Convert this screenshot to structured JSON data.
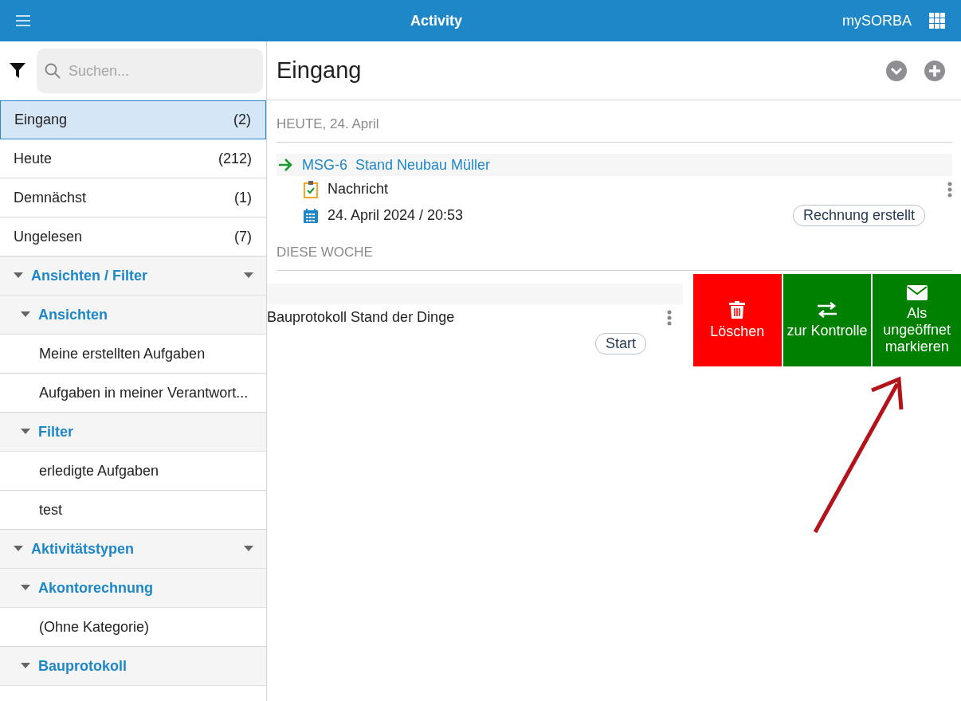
{
  "topbar": {
    "title": "Activity",
    "brand": "mySORBA"
  },
  "sidebar": {
    "search": {
      "placeholder": "Suchen..."
    },
    "nav": [
      {
        "label": "Eingang",
        "count": "(2)",
        "selected": true
      },
      {
        "label": "Heute",
        "count": "(212)",
        "selected": false
      },
      {
        "label": "Demnächst",
        "count": "(1)",
        "selected": false
      },
      {
        "label": "Ungelesen",
        "count": "(7)",
        "selected": false
      }
    ],
    "sections": [
      {
        "label": "Ansichten / Filter",
        "expanded": true,
        "children": [
          {
            "label": "Ansichten",
            "expanded": true,
            "children": [
              {
                "label": "Meine erstellten Aufgaben"
              },
              {
                "label": "Aufgaben in meiner Verantwort..."
              }
            ]
          },
          {
            "label": "Filter",
            "expanded": true,
            "children": [
              {
                "label": "erledigte Aufgaben"
              },
              {
                "label": "test"
              }
            ]
          }
        ]
      },
      {
        "label": "Aktivitätstypen",
        "expanded": true,
        "children": [
          {
            "label": "Akontorechnung",
            "expanded": true,
            "children": [
              {
                "label": "(Ohne Kategorie)"
              }
            ]
          },
          {
            "label": "Bauprotokoll",
            "expanded": true
          }
        ]
      }
    ]
  },
  "main": {
    "title": "Eingang",
    "groups": [
      {
        "heading": "HEUTE, 24. April",
        "items": [
          {
            "kind": "task",
            "title": "MSG-6  Stand Neubau Müller",
            "type": "Nachricht",
            "date": "24. April 2024 / 20:53",
            "tag": "Rechnung erstellt"
          }
        ]
      },
      {
        "heading": "DIESE WOCHE",
        "items": [
          {
            "kind": "swiped",
            "title": "Bauprotokoll Stand der Dinge",
            "tag": "Start",
            "actions": [
              {
                "kind": "delete",
                "label": "Löschen",
                "color": "#ff0000"
              },
              {
                "kind": "transfer",
                "label": "zur Kontrolle",
                "color": "#008000"
              },
              {
                "kind": "unread",
                "label": "Als ungeöffnet markieren",
                "color": "#008000"
              }
            ]
          }
        ]
      }
    ]
  }
}
